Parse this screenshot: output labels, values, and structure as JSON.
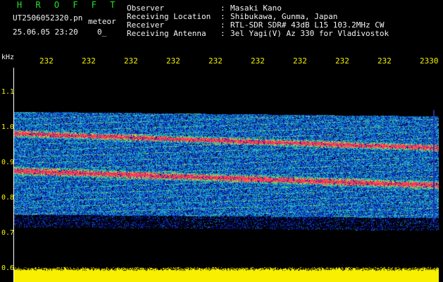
{
  "header": {
    "brand": "H R O F F T",
    "filename": "UT2506052320.pn",
    "tag": "meteor",
    "datetime": "25.06.05 23:20",
    "counter": "0_",
    "info_rows": [
      {
        "label": "Observer",
        "value": "Masaki Kano"
      },
      {
        "label": "Receiving Location",
        "value": "Shibukawa, Gunma, Japan"
      },
      {
        "label": "Receiver",
        "value": "RTL-SDR SDR# 43dB L15 103.2MHz CW"
      },
      {
        "label": "Receiving Antenna",
        "value": "3el Yagi(V) Az 330 for Vladivostok"
      }
    ]
  },
  "axes": {
    "y_unit": "kHz",
    "x_ticks": [
      "232",
      "232",
      "232",
      "232",
      "232",
      "232",
      "232",
      "232",
      "232",
      "2330"
    ],
    "y_ticks": [
      "1.1",
      "1.0",
      "0.9",
      "0.8",
      "0.7",
      "0.6"
    ]
  },
  "colors": {
    "background": "#000000",
    "text": "#f4f4f4",
    "accent": "#f4f400",
    "brand": "#27e427",
    "noise_floor": "#f8f800",
    "signal_strong": "#ff3c5c",
    "signal_mid": "#3cd28c",
    "signal_low": "#1e3cc8"
  }
}
